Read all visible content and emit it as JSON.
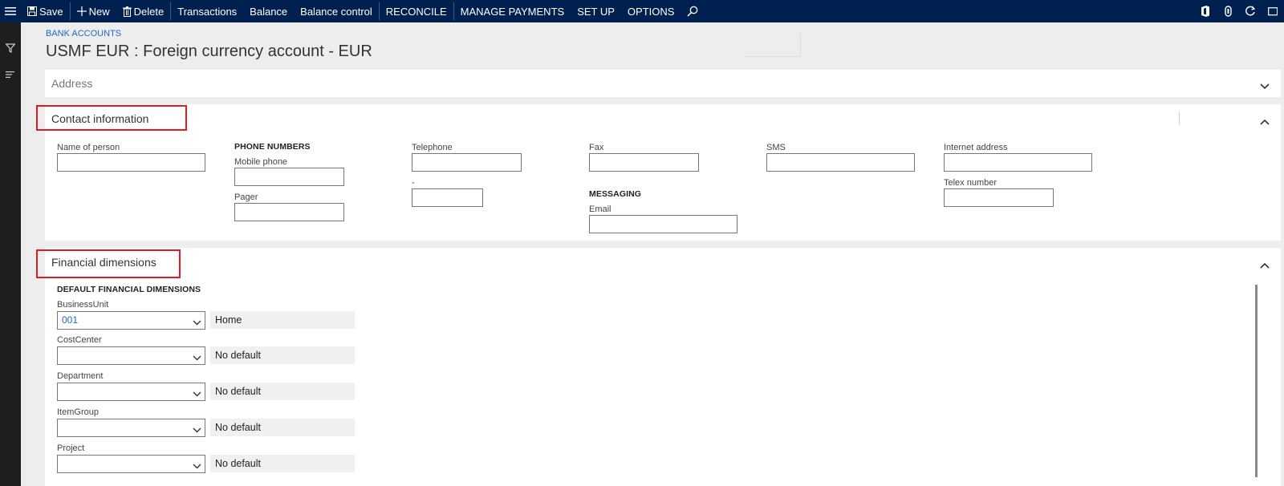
{
  "toolbar": {
    "save": "Save",
    "new": "New",
    "delete": "Delete",
    "transactions": "Transactions",
    "balance": "Balance",
    "balance_control": "Balance control",
    "reconcile": "RECONCILE",
    "manage_payments": "MANAGE PAYMENTS",
    "set_up": "SET UP",
    "options": "OPTIONS",
    "icons": [
      "hamburger-icon",
      "save-icon",
      "plus-icon",
      "trash-icon",
      "search-icon",
      "office-icon",
      "attach-icon",
      "refresh-icon",
      "window-icon"
    ]
  },
  "breadcrumb": "BANK ACCOUNTS",
  "page_title": "USMF EUR : Foreign currency account - EUR",
  "address": {
    "header": "Address"
  },
  "contact": {
    "header": "Contact information",
    "name_of_person": "Name of person",
    "phone_numbers": "PHONE NUMBERS",
    "mobile_phone": "Mobile phone",
    "pager": "Pager",
    "telephone": "Telephone",
    "extension": "-",
    "fax": "Fax",
    "messaging": "MESSAGING",
    "email": "Email",
    "sms": "SMS",
    "internet_address": "Internet address",
    "telex_number": "Telex number"
  },
  "financial": {
    "header": "Financial dimensions",
    "section": "DEFAULT FINANCIAL DIMENSIONS",
    "dimensions": [
      {
        "label": "BusinessUnit",
        "value": "001",
        "description": "Home"
      },
      {
        "label": "CostCenter",
        "value": "",
        "description": "No default"
      },
      {
        "label": "Department",
        "value": "",
        "description": "No default"
      },
      {
        "label": "ItemGroup",
        "value": "",
        "description": "No default"
      },
      {
        "label": "Project",
        "value": "",
        "description": "No default"
      }
    ]
  },
  "colors": {
    "toolbar_bg": "#002050",
    "link": "#2266c4",
    "highlight": "#e01b24",
    "leftnav": "#1e1e1e"
  }
}
